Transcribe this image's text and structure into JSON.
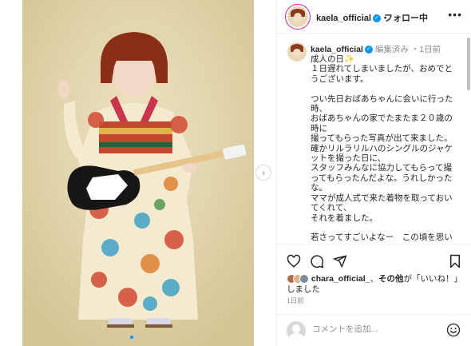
{
  "header": {
    "username": "kaela_official",
    "separator": "・",
    "follow_label": "フォロー中",
    "more": "•••"
  },
  "caption": {
    "username": "kaela_official",
    "edited": "編集済み",
    "time": "1日前",
    "body": "成人の日✨\n１日遅れてしまいましたが、おめでとうございます。\n\nつい先日おばあちゃんに会いに行った時、\nおばあちゃんの家でたまたま２０歳の時に\n撮ってもらった写真が出て来ました。\n確かリルラリルハのシングルのジャケットを撮った日に、\nスタッフみんなに協力してもらって撮ってもらったんだよな。うれしかったな。\nママが成人式で来た着物を取っておいてくれて、\nそれを着ました。\n\n若さってすごいよなー　この頃を思い"
  },
  "actions": {
    "like_icon": "heart-icon",
    "comment_icon": "comment-icon",
    "share_icon": "share-icon",
    "save_icon": "bookmark-icon"
  },
  "likes": {
    "user": "chara_official_",
    "text_mid": "、",
    "others": "その他",
    "text_end": "が「いいね！」しました"
  },
  "timestamp": "1日前",
  "comment": {
    "placeholder": "コメントを追加...",
    "emoji_icon": "smiley-icon"
  },
  "colors": {
    "accent": "#0095f6",
    "border": "#efefef",
    "muted": "#8e8e8e"
  }
}
